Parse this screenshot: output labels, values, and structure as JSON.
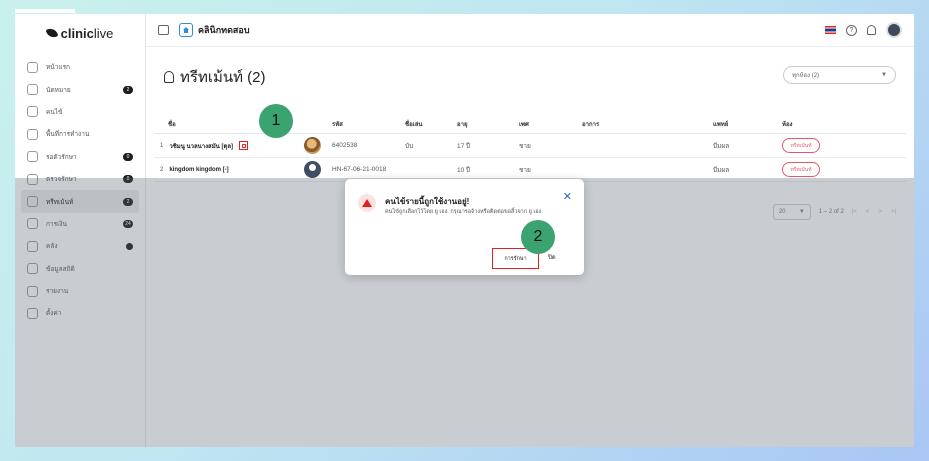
{
  "app": {
    "logo_bold": "clinic",
    "logo_light": "live"
  },
  "sidebar": {
    "items": [
      {
        "label": "หน้าแรก",
        "badge": ""
      },
      {
        "label": "นัดหมาย",
        "badge": "2"
      },
      {
        "label": "คนไข้",
        "badge": ""
      },
      {
        "label": "พื้นที่การทำงาน",
        "badge": ""
      },
      {
        "label": "รอตัวรักษา",
        "badge": "0"
      },
      {
        "label": "ตรวจรักษา",
        "badge": "0"
      },
      {
        "label": "ทรีทเม้นท์",
        "badge": "2"
      },
      {
        "label": "การเงิน",
        "badge": "24"
      },
      {
        "label": "คลัง",
        "badge": ""
      },
      {
        "label": "ข้อมูลสถิติ",
        "badge": ""
      },
      {
        "label": "รายงาน",
        "badge": ""
      },
      {
        "label": "ตั้งค่า",
        "badge": ""
      }
    ]
  },
  "header": {
    "clinic_name": "คลินิกทดสอบ"
  },
  "page": {
    "title": "ทรีทเม้นท์ (2)",
    "room_filter": "ทุกห้อง (2)"
  },
  "table": {
    "headers": {
      "name": "ชื่อ",
      "hn": "รหัส",
      "nick": "ชื่อเล่น",
      "age": "อายุ",
      "sex": "เพศ",
      "symptom": "อาการ",
      "doctor": "แพทย์",
      "room": "ห้อง"
    },
    "rows": [
      {
        "num": "1",
        "name": "วชิมนู นวลนางสมัน [ดุล]",
        "hn": "6402538",
        "nick": "บับ",
        "age": "17 ปี",
        "sex": "ชาย",
        "symptom": "",
        "doctor": "บีมผล",
        "room": "ทรีทเม้นท์"
      },
      {
        "num": "2",
        "name": "kingdom kingdom [-]",
        "hn": "HN-67-06-21-0018",
        "nick": "",
        "age": "10 ปี",
        "sex": "ชาย",
        "symptom": "",
        "doctor": "บีมผล",
        "room": "ทรีทเม้นท์"
      }
    ]
  },
  "pagination": {
    "page_size": "20",
    "range": "1 – 2 of 2"
  },
  "modal": {
    "title": "คนไข้รายนี้ถูกใช้งานอยู่!",
    "body": "คนไข้ถูกเลือกไว้โดย ยู เอง. กรุณารอจ้างหรือติดต่อขอสิ้วจาก ยู เอง.",
    "primary_label": "การรักษา",
    "close_label": "ปิด"
  },
  "annotations": {
    "step1": "1",
    "step2": "2"
  },
  "colors": {
    "accent": "#3aa36f",
    "highlight": "#e0201e",
    "badge": "#e05a6a"
  }
}
